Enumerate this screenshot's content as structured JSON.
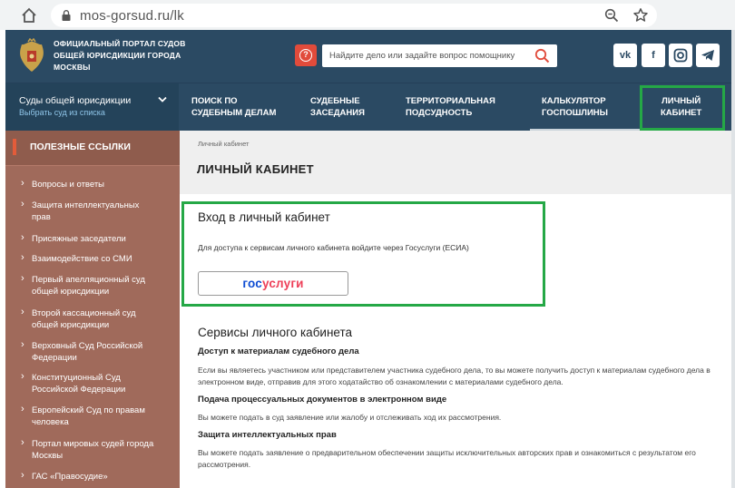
{
  "browser": {
    "url": "mos-gorsud.ru/lk"
  },
  "header": {
    "portal_title": "ОФИЦИАЛЬНЫЙ ПОРТАЛ СУДОВ ОБЩЕЙ ЮРИСДИКЦИИ ГОРОДА МОСКВЫ",
    "search_placeholder": "Найдите дело или задайте вопрос помощнику",
    "social": [
      "vk-icon",
      "facebook-icon",
      "instagram-icon",
      "telegram-icon"
    ]
  },
  "nav": {
    "court_select_title": "Суды общей юрисдикции",
    "court_select_sub": "Выбрать суд из списка",
    "items": [
      {
        "line1": "ПОИСК ПО",
        "line2": "СУДЕБНЫМ ДЕЛАМ"
      },
      {
        "line1": "СУДЕБНЫЕ",
        "line2": "ЗАСЕДАНИЯ"
      },
      {
        "line1": "ТЕРРИТОРИАЛЬНАЯ",
        "line2": "ПОДСУДНОСТЬ"
      },
      {
        "line1": "КАЛЬКУЛЯТОР",
        "line2": "ГОСПОШЛИНЫ"
      },
      {
        "line1": "ЛИЧНЫЙ",
        "line2": "КАБИНЕТ"
      }
    ]
  },
  "sidebar": {
    "title": "ПОЛЕЗНЫЕ ССЫЛКИ",
    "items": [
      "Вопросы и ответы",
      "Защита интеллектуальных прав",
      "Присяжные заседатели",
      "Взаимодействие со СМИ",
      "Первый апелляционный суд общей юрисдикции",
      "Второй кассационный суд общей юрисдикции",
      "Верховный Суд Российской Федерации",
      "Конституционный Суд Российской Федерации",
      "Европейский Суд по правам человека",
      "Портал мировых судей города Москвы",
      "ГАС «Правосудие»"
    ]
  },
  "main": {
    "breadcrumb": "Личный кабинет",
    "page_title": "ЛИЧНЫЙ КАБИНЕТ",
    "login_title": "Вход в личный кабинет",
    "login_desc": "Для доступа к сервисам личного кабинета войдите через Госуслуги (ЕСИА)",
    "gosuslugi_a": "гос",
    "gosuslugi_b": "услуги",
    "services_title": "Сервисы личного кабинета",
    "services": [
      {
        "heading": "Доступ к материалам судебного дела",
        "text": "Если вы являетесь участником или представителем участника судебного дела, то вы можете получить доступ к материалам судебного дела в электронном виде, отправив для этого ходатайство об ознакомлении с материалами судебного дела."
      },
      {
        "heading": "Подача процессуальных документов в электронном виде",
        "text": "Вы можете подать в суд заявление или жалобу и отслеживать ход их рассмотрения."
      },
      {
        "heading": "Защита интеллектуальных прав",
        "text": "Вы можете подать заявление о предварительном обеспечении защиты исключительных авторских прав и ознакомиться с результатом его рассмотрения."
      }
    ]
  },
  "colors": {
    "header_bg": "#2b4a63",
    "sidebar_bg": "#a06a5b",
    "highlight": "#25a846",
    "help_red": "#e14b3b"
  }
}
